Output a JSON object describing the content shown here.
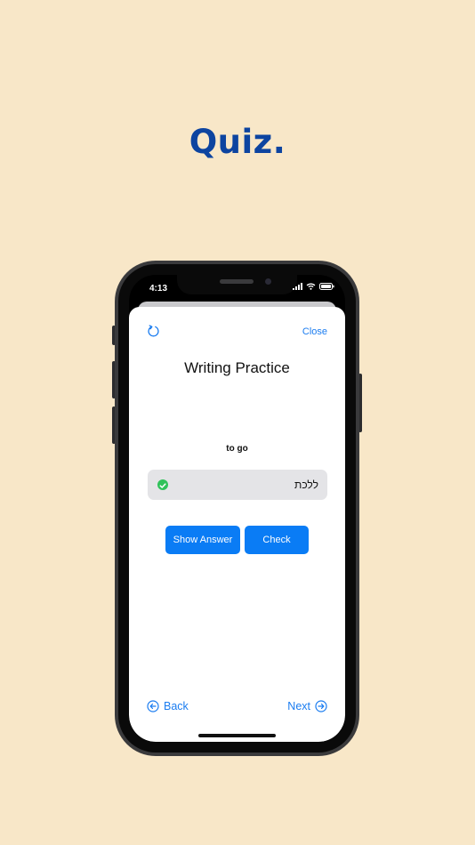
{
  "headline": "Quiz.",
  "status_bar": {
    "time": "4:13",
    "icons": [
      "signal-icon",
      "wifi-icon",
      "battery-icon"
    ]
  },
  "quiz": {
    "close_label": "Close",
    "title": "Writing Practice",
    "prompt": "to go",
    "answer_value": "ללכת",
    "answer_correct": true,
    "show_answer_label": "Show Answer",
    "check_label": "Check",
    "back_label": "Back",
    "next_label": "Next"
  },
  "colors": {
    "background": "#f8e7c8",
    "headline": "#0d44a0",
    "accent": "#0a7cf5",
    "success": "#30c25a"
  }
}
